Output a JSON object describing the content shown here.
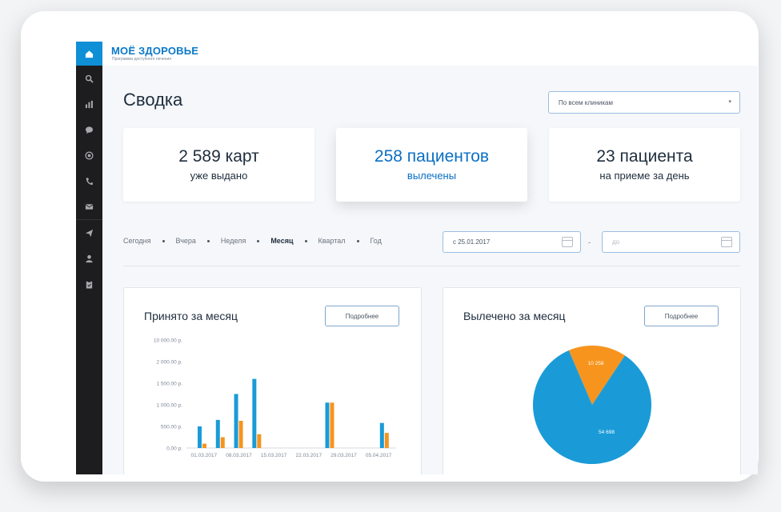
{
  "app": {
    "logo_title": "МОЁ ЗДОРОВЬЕ",
    "logo_subtitle": "Программа доступного лечения",
    "accent": "#0f8fd6"
  },
  "sidebar": {
    "items": [
      {
        "icon": "home-icon"
      },
      {
        "icon": "search-icon"
      },
      {
        "icon": "bar-chart-icon"
      },
      {
        "icon": "chat-icon"
      },
      {
        "icon": "globe-icon"
      },
      {
        "icon": "phone-icon"
      },
      {
        "icon": "mail-icon"
      },
      {
        "icon": "send-icon"
      },
      {
        "icon": "user-icon"
      },
      {
        "icon": "clipboard-icon"
      }
    ]
  },
  "page": {
    "title": "Сводка",
    "clinic_select": {
      "value": "По всем клиникам"
    }
  },
  "stats": [
    {
      "main": "2 589 карт",
      "sub": "уже выдано"
    },
    {
      "main": "258 пациентов",
      "sub": "вылечены"
    },
    {
      "main": "23 пациента",
      "sub": "на приеме за день"
    }
  ],
  "periods": [
    "Сегодня",
    "Вчера",
    "Неделя",
    "Месяц",
    "Квартал",
    "Год"
  ],
  "active_period": "Месяц",
  "date_from": {
    "value": "с 25.01.2017"
  },
  "date_dash": "-",
  "date_to": {
    "placeholder": "до"
  },
  "panels": {
    "accepted": {
      "title": "Принято за месяц",
      "button": "Подробнее"
    },
    "cured": {
      "title": "Вылечено за месяц",
      "button": "Подробнее"
    }
  },
  "chart_data": [
    {
      "type": "bar",
      "title": "Принято за месяц",
      "y_ticks": [
        "10 000.00 р.",
        "2 000.00 р.",
        "1 500.00 р.",
        "1 000.00 р.",
        "500.00 р.",
        "0,00 р."
      ],
      "x_ticks": [
        "01.03.2017",
        "08.03.2017",
        "15.03.2017",
        "22.03.2017",
        "29.03.2017",
        "05.04.2017"
      ],
      "colors": [
        "#1a9bd7",
        "#f7941d"
      ],
      "groups": [
        {
          "blue": 500,
          "orange": 100
        },
        {
          "blue": 650,
          "orange": 250
        },
        {
          "blue": 1250,
          "orange": 630
        },
        {
          "blue": 1600,
          "orange": 320
        },
        {
          "blue": 0,
          "orange": 0
        },
        {
          "blue": 0,
          "orange": 0
        },
        {
          "blue": 0,
          "orange": 0
        },
        {
          "blue": 1050,
          "orange": 1050
        },
        {
          "blue": 0,
          "orange": 0
        },
        {
          "blue": 0,
          "orange": 0
        },
        {
          "blue": 580,
          "orange": 350
        }
      ],
      "ylim": [
        0,
        2000
      ]
    },
    {
      "type": "pie",
      "title": "Вылечено за месяц",
      "slices": [
        {
          "label": "10 258",
          "value": 10258,
          "color": "#f7941d"
        },
        {
          "label": "54 698",
          "value": 54698,
          "color": "#1a9bd7"
        }
      ]
    }
  ]
}
